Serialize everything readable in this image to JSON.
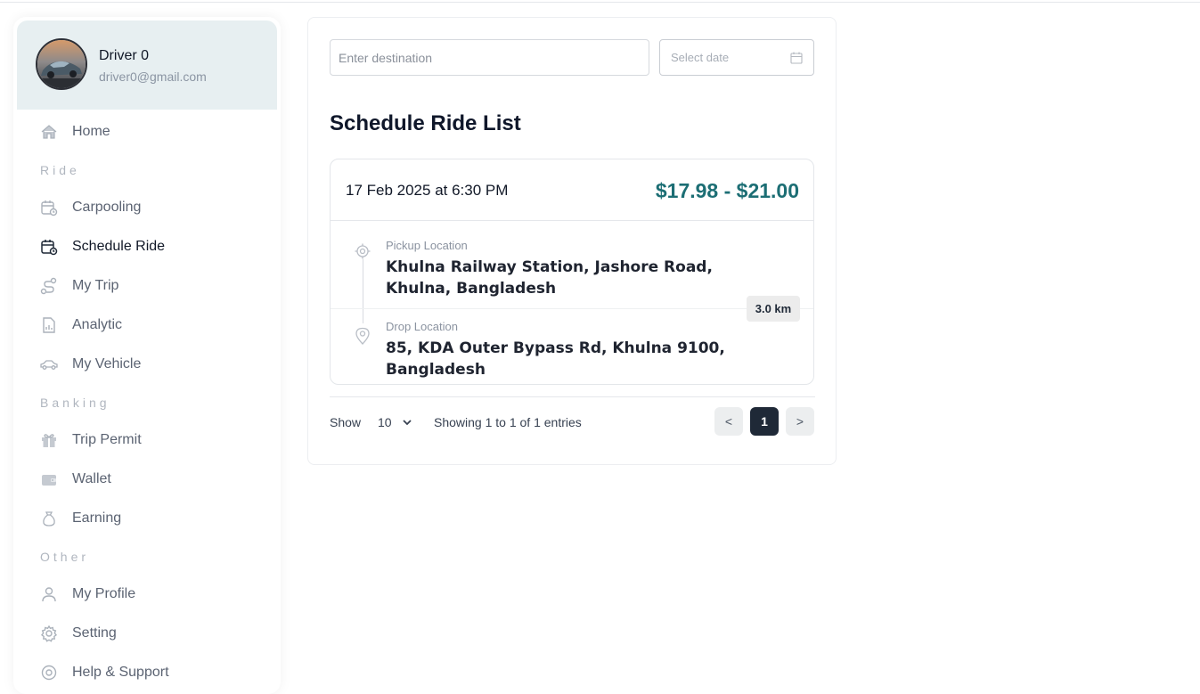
{
  "profile": {
    "name": "Driver 0",
    "email": "driver0@gmail.com"
  },
  "sidebar": {
    "home": "Home",
    "section_ride": "Ride",
    "ride_items": [
      "Carpooling",
      "Schedule Ride",
      "My Trip",
      "Analytic",
      "My Vehicle"
    ],
    "section_banking": "Banking",
    "banking_items": [
      "Trip Permit",
      "Wallet",
      "Earning"
    ],
    "section_other": "Other",
    "other_items": [
      "My Profile",
      "Setting",
      "Help & Support"
    ],
    "active_item": "Schedule Ride"
  },
  "filters": {
    "destination_placeholder": "Enter destination",
    "date_placeholder": "Select date"
  },
  "page_title": "Schedule Ride List",
  "ride": {
    "datetime": "17 Feb 2025 at 6:30 PM",
    "price": "$17.98 - $21.00",
    "pickup_label": "Pickup Location",
    "pickup_address": "Khulna Railway Station, Jashore Road, Khulna, Bangladesh",
    "drop_label": "Drop Location",
    "drop_address": "85, KDA Outer Bypass Rd, Khulna 9100, Bangladesh",
    "distance": "3.0 km"
  },
  "table_footer": {
    "show_label": "Show",
    "page_size": "10",
    "entries_text": "Showing 1 to 1 of 1 entries",
    "prev": "<",
    "current_page": "1",
    "next": ">"
  },
  "colors": {
    "accent": "#1c6e74",
    "profile_bg": "#e7eff1",
    "active_page": "#1f2937"
  }
}
